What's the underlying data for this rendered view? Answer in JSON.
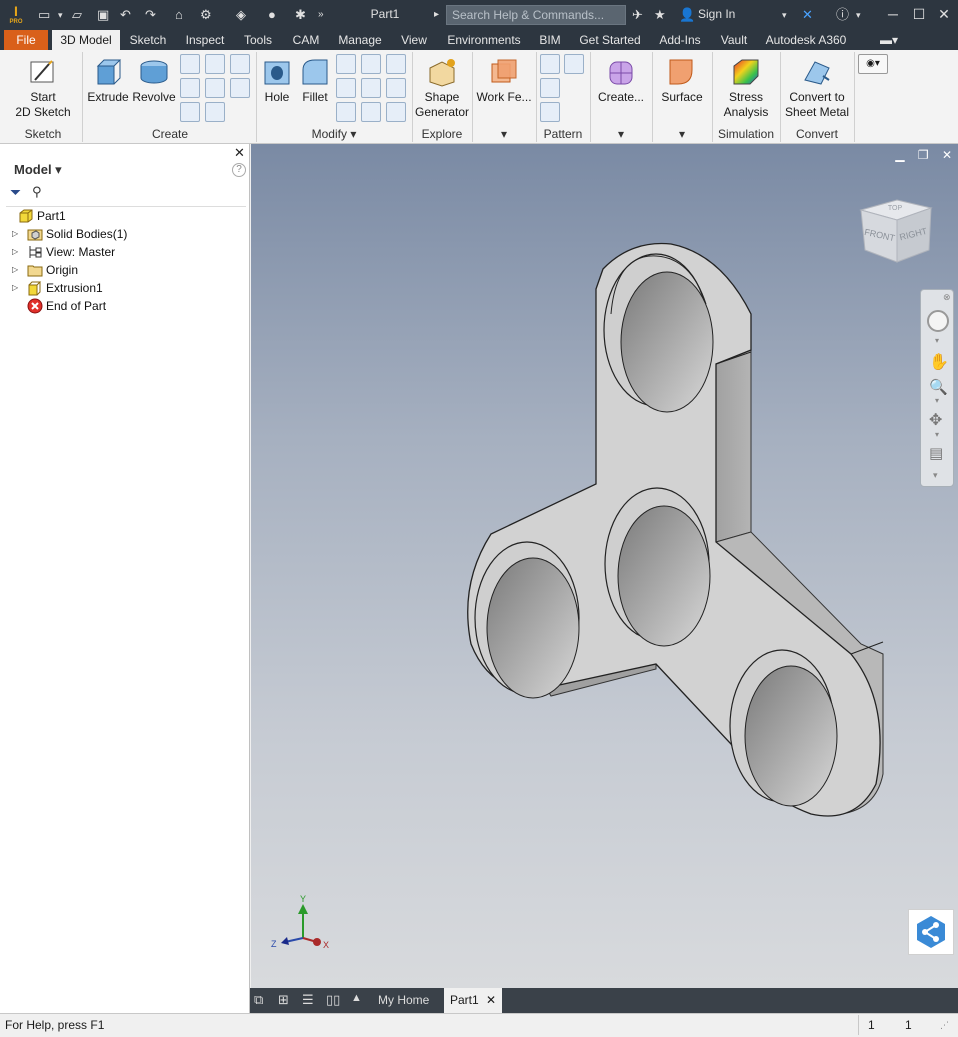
{
  "app": {
    "logo_text": "I",
    "logo_sub": "PRO",
    "document_title": "Part1",
    "search_placeholder": "Search Help & Commands...",
    "sign_in": "Sign In",
    "window_controls": [
      "minimize-icon",
      "maximize-icon",
      "close-icon"
    ]
  },
  "tabs": [
    {
      "label": "File"
    },
    {
      "label": "3D Model"
    },
    {
      "label": "Sketch"
    },
    {
      "label": "Inspect"
    },
    {
      "label": "Tools"
    },
    {
      "label": "CAM"
    },
    {
      "label": "Manage"
    },
    {
      "label": "View"
    },
    {
      "label": "Environments"
    },
    {
      "label": "BIM"
    },
    {
      "label": "Get Started"
    },
    {
      "label": "Add-Ins"
    },
    {
      "label": "Vault"
    },
    {
      "label": "Autodesk A360"
    }
  ],
  "ribbon": {
    "start_sketch": "Start\n2D Sketch",
    "start_sketch_l1": "Start",
    "start_sketch_l2": "2D Sketch",
    "extrude": "Extrude",
    "revolve": "Revolve",
    "hole": "Hole",
    "fillet": "Fillet",
    "shape_gen_l1": "Shape",
    "shape_gen_l2": "Generator",
    "work_features": "Work Fe...",
    "create_freeform": "Create...",
    "surface": "Surface",
    "stress_l1": "Stress",
    "stress_l2": "Analysis",
    "convert_l1": "Convert to",
    "convert_l2": "Sheet Metal",
    "groups": {
      "sketch": "Sketch",
      "create": "Create",
      "modify": "Modify",
      "explore": "Explore",
      "pattern": "Pattern",
      "simulation": "Simulation",
      "convert": "Convert"
    }
  },
  "browser": {
    "title": "Model",
    "help": "?",
    "items": [
      {
        "label": "Part1",
        "icon": "part-icon"
      },
      {
        "label": "Solid Bodies(1)",
        "icon": "solid-bodies-icon"
      },
      {
        "label": "View: Master",
        "icon": "view-icon"
      },
      {
        "label": "Origin",
        "icon": "folder-icon"
      },
      {
        "label": "Extrusion1",
        "icon": "extrusion-icon"
      },
      {
        "label": "End of Part",
        "icon": "end-of-part-icon"
      }
    ]
  },
  "viewport": {
    "viewcube_front": "FRONT",
    "viewcube_right": "RIGHT",
    "viewcube_top": "TOP",
    "axis_x": "X",
    "axis_y": "Y",
    "axis_z": "Z"
  },
  "doc_tabs": {
    "home": "My Home",
    "part": "Part1"
  },
  "status": {
    "help_text": "For Help, press F1",
    "count_1": "1",
    "count_2": "1"
  }
}
